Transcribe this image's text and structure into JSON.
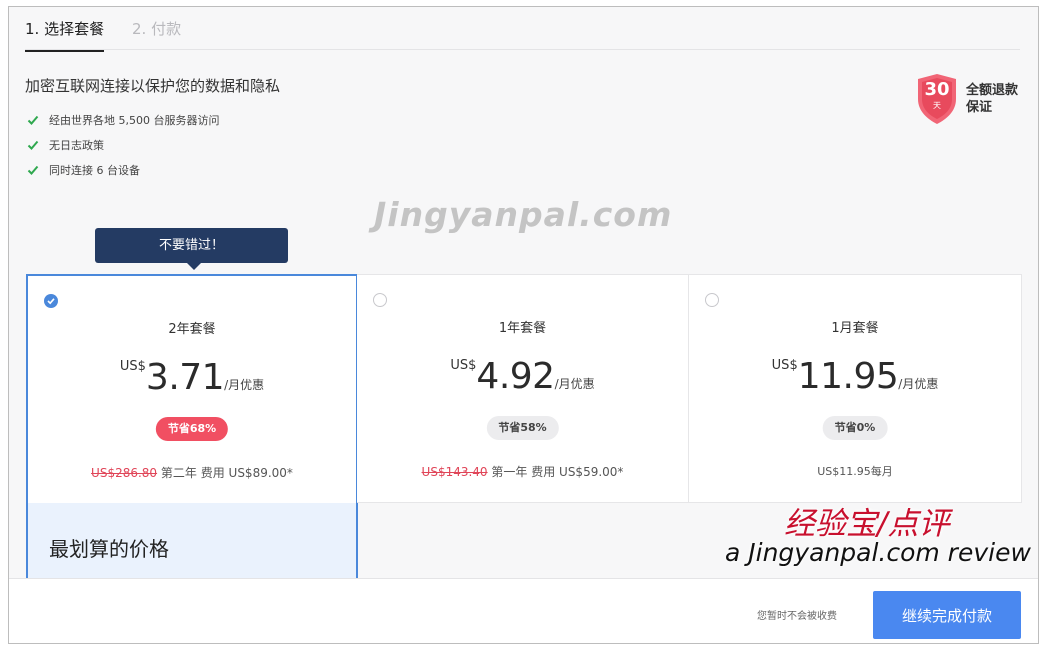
{
  "steps": [
    {
      "label": "1. 选择套餐"
    },
    {
      "label": "2. 付款"
    }
  ],
  "headline": "加密互联网连接以保护您的数据和隐私",
  "features": [
    "经由世界各地 5,500 台服务器访问",
    "无日志政策",
    "同时连接 6 台设备"
  ],
  "guarantee": {
    "days": "30",
    "unit": "天",
    "text": "全额退款保证"
  },
  "watermark": "Jingyanpal.com",
  "tooltip": "不要错过！",
  "plans": [
    {
      "name": "2年套餐",
      "currency": "US$",
      "price": "3.71",
      "per": "/月优惠",
      "badge": "节省68%",
      "old_price": "US$286.80",
      "fine": "第二年 费用 US$89.00*",
      "best_label": "最划算的价格"
    },
    {
      "name": "1年套餐",
      "currency": "US$",
      "price": "4.92",
      "per": "/月优惠",
      "badge": "节省58%",
      "old_price": "US$143.40",
      "fine": "第一年 费用 US$59.00*"
    },
    {
      "name": "1月套餐",
      "currency": "US$",
      "price": "11.95",
      "per": "/月优惠",
      "badge": "节省0%",
      "fine": "US$11.95每月"
    }
  ],
  "review": {
    "cn": "经验宝/点评",
    "en": "a Jingyanpal.com review"
  },
  "footer": {
    "note": "您暂时不会被收费",
    "button": "继续完成付款"
  },
  "colors": {
    "accent": "#4a88db",
    "hot": "#f14f62",
    "navy": "#243b63",
    "check": "#2fa84f"
  }
}
